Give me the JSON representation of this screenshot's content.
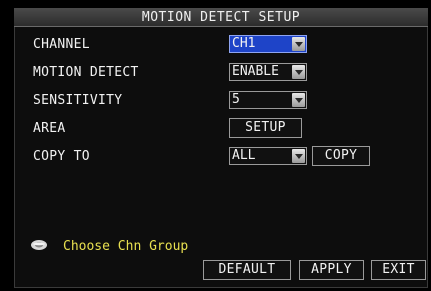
{
  "title": "MOTION DETECT SETUP",
  "settings": [
    {
      "label": "CHANNEL",
      "value": "CH1",
      "control": "dropdown"
    },
    {
      "label": "MOTION DETECT",
      "value": "ENABLE",
      "control": "dropdown"
    },
    {
      "label": "SENSITIVITY",
      "value": "5",
      "control": "dropdown"
    },
    {
      "label": "AREA",
      "value": "SETUP",
      "control": "button"
    },
    {
      "label": "COPY TO",
      "value": "ALL",
      "control": "dropdown",
      "extra_button": "COPY"
    }
  ],
  "hint": {
    "icon": "info-icon",
    "text": "Choose Chn Group",
    "color": "#e8e050"
  },
  "footer": {
    "default_label": "DEFAULT",
    "apply_label": "APPLY",
    "exit_label": "EXIT"
  },
  "colors": {
    "selection": "#1e44c8",
    "background": "#0d0d0d"
  }
}
